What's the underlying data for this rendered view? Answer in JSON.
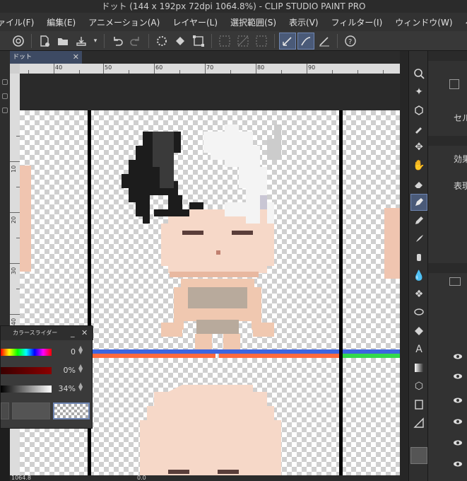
{
  "title": "ドット (144 x 192px 72dpi 1064.8%) - CLIP STUDIO PAINT PRO",
  "menu": [
    "ァイル(F)",
    "編集(E)",
    "アニメーション(A)",
    "レイヤー(L)",
    "選択範囲(S)",
    "表示(V)",
    "フィルター(I)",
    "ウィンドウ(W)",
    "ヘルプ(H)"
  ],
  "doc_tab": {
    "label": "ドット",
    "close": "✕"
  },
  "ruler_h": [
    "40",
    "50",
    "60",
    "70",
    "80",
    "90"
  ],
  "ruler_v": [
    "10",
    "20",
    "30",
    "40"
  ],
  "right_panel": {
    "label_1": "セル",
    "label_2": "効果",
    "label_3": "表現"
  },
  "color_slider": {
    "title": "カラースライダー",
    "hue_value": "0",
    "sat_value": "0%",
    "val_value": "34%",
    "minimize": "_",
    "close": "✕"
  },
  "status": {
    "zoom": "1064.8",
    "angle": "0.0"
  },
  "colors": {
    "accent": "#4a5a78",
    "bg": "#1e1e1e",
    "line_blue": "#3d66e0",
    "line_orange": "#ff6a3d",
    "line_green": "#34d94c"
  }
}
